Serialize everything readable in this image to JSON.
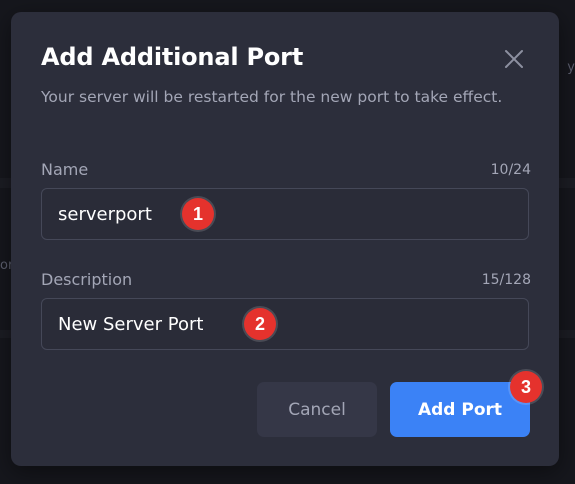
{
  "background": {
    "right_fragment": "y",
    "left_fragment": "or"
  },
  "dialog": {
    "title": "Add Additional Port",
    "subtitle": "Your server will be restarted for the new port to take effect.",
    "close_icon": "close-icon",
    "fields": {
      "name": {
        "label": "Name",
        "counter": "10/24",
        "value": "serverport"
      },
      "description": {
        "label": "Description",
        "counter": "15/128",
        "value": "New Server Port"
      }
    },
    "buttons": {
      "cancel": "Cancel",
      "add": "Add Port"
    }
  },
  "annotations": [
    "1",
    "2",
    "3"
  ],
  "colors": {
    "dialog_bg": "#2c2e3b",
    "accent": "#3b82f6",
    "badge": "#e5322d"
  }
}
